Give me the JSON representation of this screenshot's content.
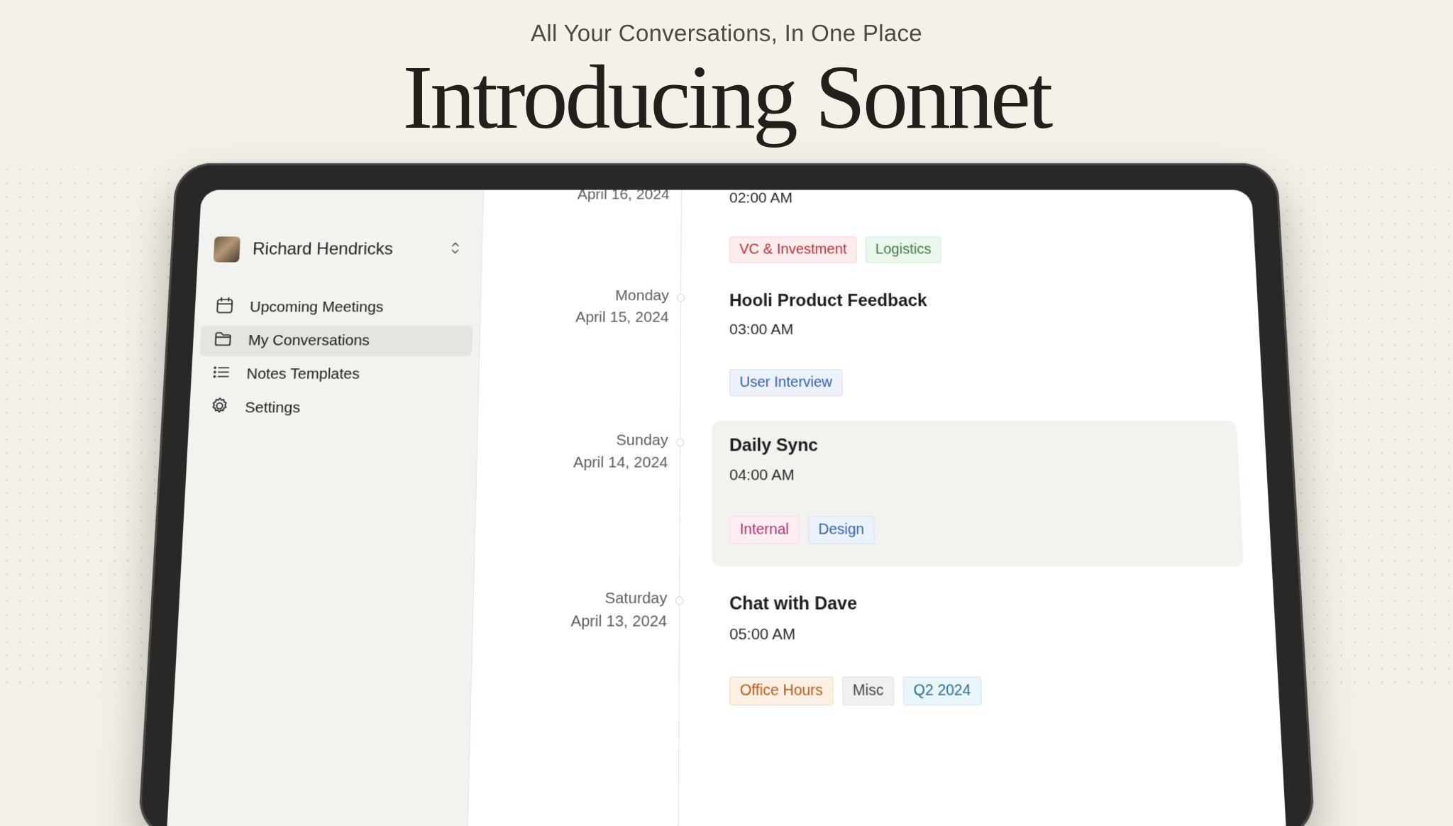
{
  "hero": {
    "subtitle": "All Your Conversations, In One Place",
    "title": "Introducing Sonnet"
  },
  "sidebar": {
    "user_name": "Richard Hendricks",
    "items": [
      {
        "label": "Upcoming Meetings",
        "icon": "calendar-icon",
        "active": false
      },
      {
        "label": "My Conversations",
        "icon": "folder-icon",
        "active": true
      },
      {
        "label": "Notes Templates",
        "icon": "list-icon",
        "active": false
      },
      {
        "label": "Settings",
        "icon": "gear-icon",
        "active": false
      }
    ]
  },
  "timeline": [
    {
      "day": "",
      "date": "April 16, 2024",
      "title": "",
      "time": "02:00 AM",
      "tags": [
        {
          "label": "VC & Investment",
          "color": "red"
        },
        {
          "label": "Logistics",
          "color": "green"
        }
      ]
    },
    {
      "day": "Monday",
      "date": "April 15, 2024",
      "title": "Hooli Product Feedback",
      "time": "03:00 AM",
      "tags": [
        {
          "label": "User Interview",
          "color": "blue"
        }
      ]
    },
    {
      "day": "Sunday",
      "date": "April 14, 2024",
      "title": "Daily Sync",
      "time": "04:00 AM",
      "tags": [
        {
          "label": "Internal",
          "color": "pink"
        },
        {
          "label": "Design",
          "color": "blue"
        }
      ]
    },
    {
      "day": "Saturday",
      "date": "April 13, 2024",
      "title": "Chat with Dave",
      "time": "05:00 AM",
      "tags": [
        {
          "label": "Office Hours",
          "color": "orange"
        },
        {
          "label": "Misc",
          "color": "gray"
        },
        {
          "label": "Q2 2024",
          "color": "cyan"
        }
      ]
    }
  ]
}
